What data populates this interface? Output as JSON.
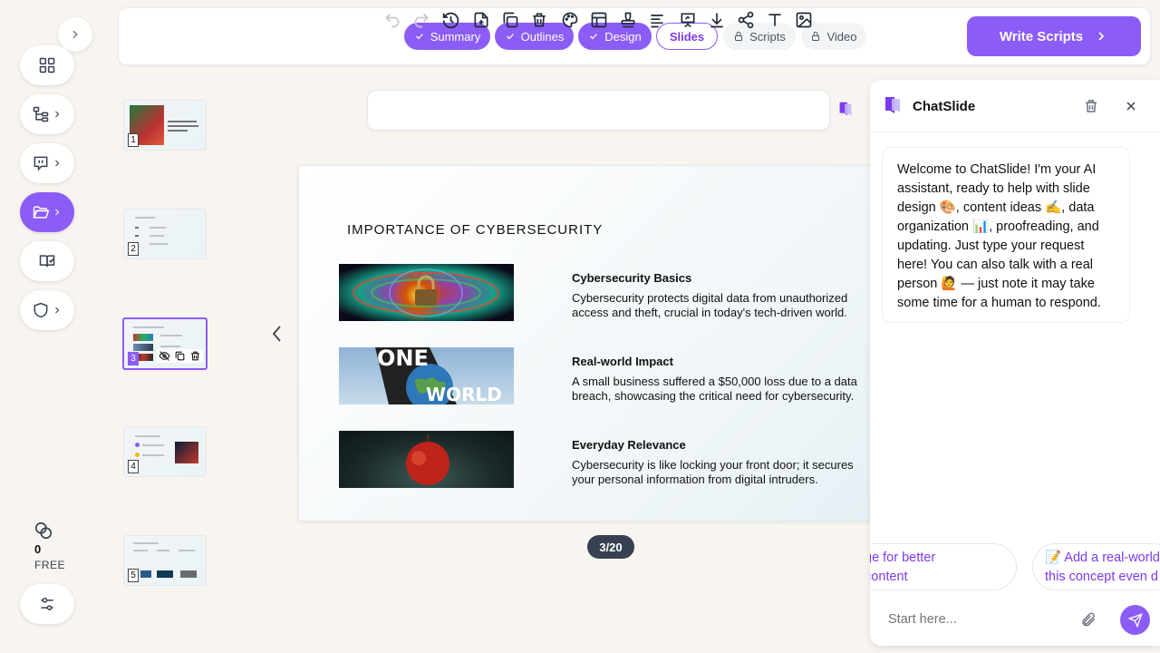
{
  "sidebar": {
    "collapse_icon": "chevron-right-icon",
    "items": [
      {
        "icon": "dashboard-icon"
      },
      {
        "icon": "outline-tree-icon"
      },
      {
        "icon": "chat-bubble-icon"
      },
      {
        "icon": "folder-open-icon",
        "active": true
      },
      {
        "icon": "book-icon"
      },
      {
        "icon": "shield-icon"
      }
    ],
    "credits_value": "0",
    "plan_label": "FREE"
  },
  "steps": [
    {
      "label": "Summary",
      "state": "done"
    },
    {
      "label": "Outlines",
      "state": "done"
    },
    {
      "label": "Design",
      "state": "done"
    },
    {
      "label": "Slides",
      "state": "current"
    },
    {
      "label": "Scripts",
      "state": "locked"
    },
    {
      "label": "Video",
      "state": "locked"
    }
  ],
  "write_scripts_label": "Write Scripts",
  "thumbnails": [
    {
      "number": "1"
    },
    {
      "number": "2"
    },
    {
      "number": "3",
      "selected": true
    },
    {
      "number": "4"
    },
    {
      "number": "5"
    }
  ],
  "slide": {
    "title": "IMPORTANCE OF CYBERSECURITY",
    "sections": [
      {
        "heading": "Cybersecurity Basics",
        "body": "Cybersecurity protects digital data from unauthorized access and theft, crucial in today's tech-driven world."
      },
      {
        "heading": "Real-world Impact",
        "body": "A small business suffered a $50,000 loss due to a data breach, showcasing the critical need for cybersecurity."
      },
      {
        "heading": "Everyday Relevance",
        "body": "Cybersecurity is like locking your front door; it secures your personal information from digital intruders."
      }
    ],
    "image2_text_top": "ONE",
    "image2_text_bottom": "WORLD"
  },
  "pager": "3/20",
  "chat": {
    "title": "ChatSlide",
    "welcome": "Welcome to ChatSlide! I'm your AI assistant, ready to help with slide design 🎨, content ideas ✍️, data organization 📊, proofreading, and updating. Just type your request here! You can also talk with a real person 🙋 — just note it may take some time for a human to respond.",
    "suggestions": [
      {
        "line1": "ge for better",
        "line2": "content"
      },
      {
        "line1": "📝 Add a real-world",
        "line2": "this concept even d"
      }
    ],
    "input_placeholder": "Start here..."
  },
  "colors": {
    "accent": "#8b5cf6",
    "accent_text": "#7c3aed"
  }
}
